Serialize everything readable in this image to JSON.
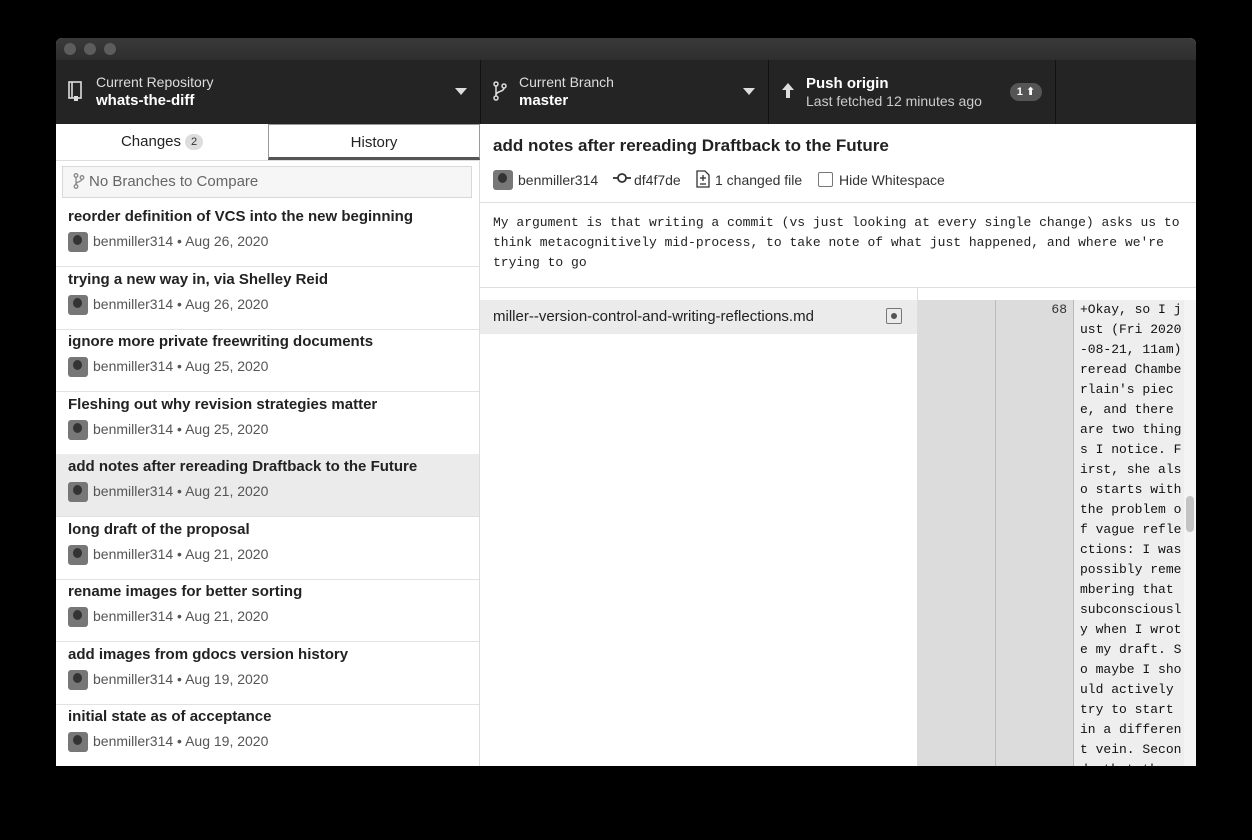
{
  "toolbar": {
    "repo_label": "Current Repository",
    "repo_value": "whats-the-diff",
    "branch_label": "Current Branch",
    "branch_value": "master",
    "push_label": "Push origin",
    "push_sub": "Last fetched 12 minutes ago",
    "push_badge": "1 ⬆"
  },
  "tabs": {
    "changes": "Changes",
    "changes_count": "2",
    "history": "History"
  },
  "compare_placeholder": "No Branches to Compare",
  "commits": [
    {
      "title": "reorder definition of VCS into the new beginning",
      "meta": "benmiller314 • Aug 26, 2020"
    },
    {
      "title": "trying a new way in, via Shelley Reid",
      "meta": "benmiller314 • Aug 26, 2020"
    },
    {
      "title": "ignore more private freewriting documents",
      "meta": "benmiller314 • Aug 25, 2020"
    },
    {
      "title": "Fleshing out why revision strategies matter",
      "meta": "benmiller314 • Aug 25, 2020"
    },
    {
      "title": "add notes after rereading Draftback to the Future",
      "meta": "benmiller314 • Aug 21, 2020"
    },
    {
      "title": "long draft of the proposal",
      "meta": "benmiller314 • Aug 21, 2020"
    },
    {
      "title": "rename images for better sorting",
      "meta": "benmiller314 • Aug 21, 2020"
    },
    {
      "title": "add images from gdocs version history",
      "meta": "benmiller314 • Aug 19, 2020"
    },
    {
      "title": "initial state as of acceptance",
      "meta": "benmiller314 • Aug 19, 2020"
    }
  ],
  "selected_commit": {
    "title": "add notes after rereading Draftback to the Future",
    "author": "benmiller314",
    "sha": "df4f7de",
    "changed_files": "1 changed file",
    "hide_whitespace": "Hide Whitespace",
    "body": "My argument is that writing a commit (vs just looking at every single change) asks us to\nthink metacognitively mid-process, to take note of what just happened, and where we're\ntrying to go"
  },
  "file": {
    "name": "miller--version-control-and-writing-reflections.md"
  },
  "diff": {
    "line_number": "68",
    "text": "+Okay, so I just (Fri 2020-08-21, 11am) reread Chamberlain's piece, and there are two things I notice. First, she also starts with the problem of vague reflections: I was possibly remembering that subconsciously when I wrote my draft. So maybe I should actively try to start in a different vein. Second, that the"
  }
}
